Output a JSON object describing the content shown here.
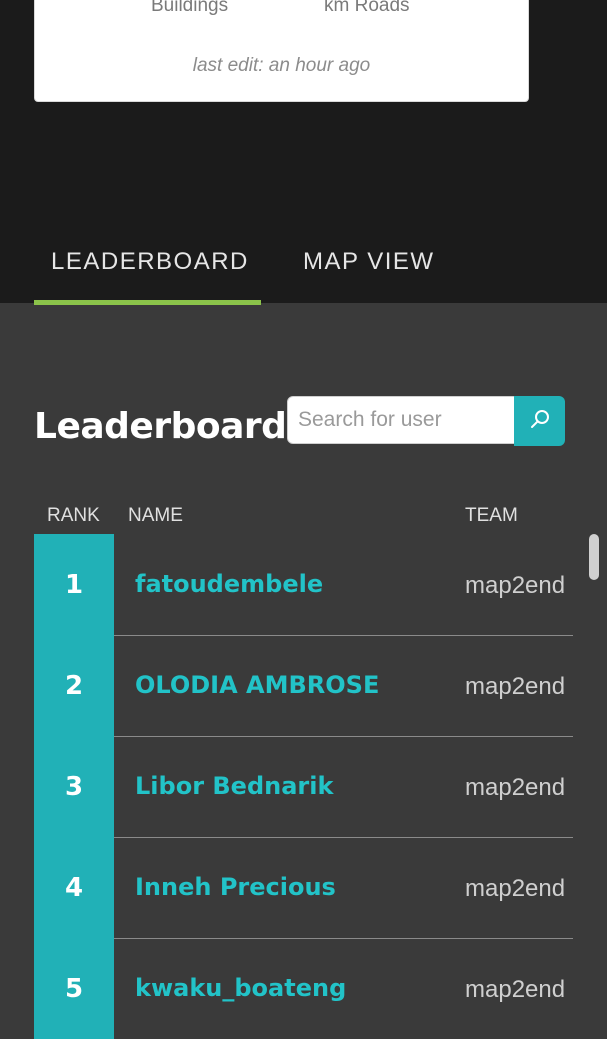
{
  "summary_card": {
    "buildings_label": "Buildings",
    "roads_label": "km Roads",
    "last_edit": "last edit: an hour ago"
  },
  "tabs": [
    {
      "label": "LEADERBOARD",
      "active": true
    },
    {
      "label": "MAP VIEW",
      "active": false
    }
  ],
  "leaderboard": {
    "title": "Leaderboard",
    "search_placeholder": "Search for user",
    "search_icon": "search-icon",
    "columns": {
      "rank": "RANK",
      "name": "NAME",
      "team": "TEAM"
    },
    "rows": [
      {
        "rank": "1",
        "name": "fatoudembele",
        "team": "map2end"
      },
      {
        "rank": "2",
        "name": "OLODIA AMBROSE",
        "team": "map2end"
      },
      {
        "rank": "3",
        "name": "Libor Bednarik",
        "team": "map2end"
      },
      {
        "rank": "4",
        "name": "Inneh Precious",
        "team": "map2end"
      },
      {
        "rank": "5",
        "name": "kwaku_boateng",
        "team": "map2end"
      }
    ]
  },
  "colors": {
    "accent": "#21b1b7",
    "tab_indicator": "#8bc34a",
    "header_bg": "#1b1b1b",
    "content_bg": "#3a3a3a"
  }
}
